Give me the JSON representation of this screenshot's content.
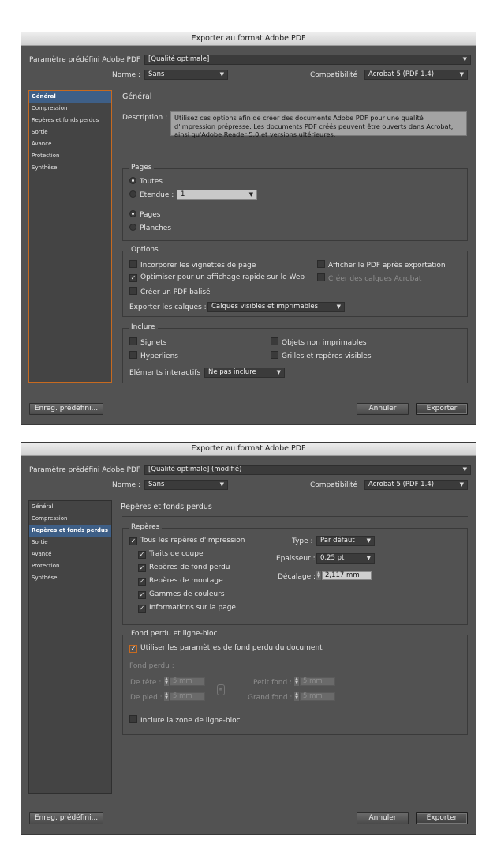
{
  "dialog1": {
    "title": "Exporter au format Adobe PDF",
    "preset_label": "Paramètre prédéfini Adobe PDF :",
    "preset_value": "[Qualité optimale]",
    "norme_label": "Norme :",
    "norme_value": "Sans",
    "compat_label": "Compatibilité :",
    "compat_value": "Acrobat 5 (PDF 1.4)",
    "sidebar": [
      "Général",
      "Compression",
      "Repères et fonds perdus",
      "Sortie",
      "Avancé",
      "Protection",
      "Synthèse"
    ],
    "active_index": 0,
    "section_title": "Général",
    "description_label": "Description :",
    "description_text": "Utilisez ces options afin de créer des documents Adobe PDF pour une qualité d'impression prépresse. Les documents PDF créés peuvent être ouverts dans Acrobat, ainsi qu'Adobe Reader 5.0 et versions ultérieures.",
    "pages": {
      "title": "Pages",
      "toutes": "Toutes",
      "etendue": "Etendue :",
      "etendue_value": "1",
      "pages": "Pages",
      "planches": "Planches"
    },
    "options": {
      "title": "Options",
      "vignettes": "Incorporer les vignettes de page",
      "optimiser": "Optimiser pour un affichage rapide sur le Web",
      "balise": "Créer un PDF balisé",
      "afficher": "Afficher le PDF après exportation",
      "calques_acrobat": "Créer des calques Acrobat",
      "exporter_label": "Exporter les calques :",
      "exporter_value": "Calques visibles et imprimables"
    },
    "inclure": {
      "title": "Inclure",
      "signets": "Signets",
      "hyperliens": "Hyperliens",
      "objets": "Objets non imprimables",
      "grilles": "Grilles et repères visibles",
      "elements_label": "Eléments interactifs :",
      "elements_value": "Ne pas inclure"
    },
    "save_preset": "Enreg. prédéfini...",
    "cancel": "Annuler",
    "export": "Exporter"
  },
  "dialog2": {
    "title": "Exporter au format Adobe PDF",
    "preset_label": "Paramètre prédéfini Adobe PDF :",
    "preset_value": "[Qualité optimale] (modifié)",
    "norme_label": "Norme :",
    "norme_value": "Sans",
    "compat_label": "Compatibilité :",
    "compat_value": "Acrobat 5 (PDF 1.4)",
    "sidebar": [
      "Général",
      "Compression",
      "Repères et fonds perdus",
      "Sortie",
      "Avancé",
      "Protection",
      "Synthèse"
    ],
    "active_index": 2,
    "section_title": "Repères et fonds perdus",
    "reperes": {
      "title": "Repères",
      "tous": "Tous les repères d'impression",
      "traits": "Traits de coupe",
      "fond_perdu": "Repères de fond perdu",
      "montage": "Repères de montage",
      "gammes": "Gammes de couleurs",
      "infos": "Informations sur la page",
      "type_label": "Type :",
      "type_value": "Par défaut",
      "epaisseur_label": "Epaisseur :",
      "epaisseur_value": "0,25 pt",
      "decalage_label": "Décalage :",
      "decalage_value": "2,117 mm"
    },
    "fond": {
      "title": "Fond perdu et ligne-bloc",
      "utiliser": "Utiliser les paramètres de fond perdu du document",
      "fond_perdu_label": "Fond perdu :",
      "tete_label": "De tête :",
      "pied_label": "De pied :",
      "petit_label": "Petit fond :",
      "grand_label": "Grand fond :",
      "value": "5 mm",
      "ligne_bloc": "Inclure la zone de ligne-bloc"
    },
    "save_preset": "Enreg. prédéfini...",
    "cancel": "Annuler",
    "export": "Exporter"
  }
}
